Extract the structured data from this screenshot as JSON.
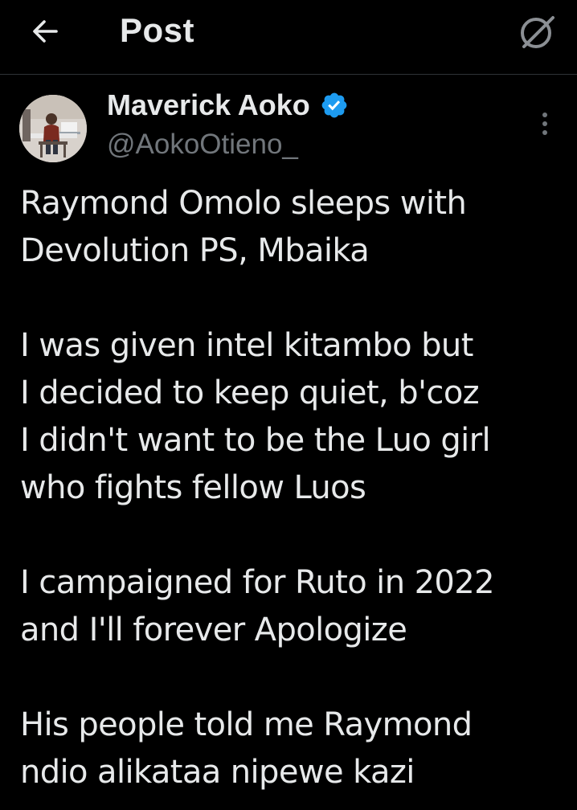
{
  "header": {
    "title": "Post",
    "back_icon": "arrow-left-icon",
    "grok_icon": "grok-icon"
  },
  "author": {
    "display_name": "Maverick Aoko",
    "handle": "@AokoOtieno_",
    "verified_icon": "verified-badge-icon",
    "more_icon": "more-vertical-icon"
  },
  "tweet": {
    "paragraphs": [
      [
        "Raymond Omolo sleeps with",
        "Devolution PS, Mbaika"
      ],
      [
        "I was given intel kitambo but",
        "I decided to keep quiet, b'coz",
        "I didn't want to be the Luo girl",
        "who fights fellow Luos"
      ],
      [
        "I campaigned for Ruto in 2022",
        "and I'll forever Apologize"
      ],
      [
        "His people told me Raymond",
        "ndio alikataa nipewe kazi"
      ]
    ]
  },
  "colors": {
    "background": "#000000",
    "text_primary": "#e7e9ea",
    "text_secondary": "#71767b",
    "verified_blue": "#1d9bf0",
    "divider": "#2f3336"
  }
}
